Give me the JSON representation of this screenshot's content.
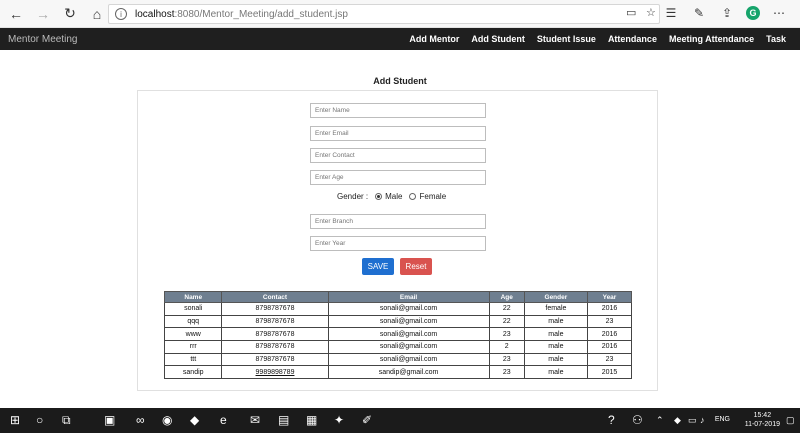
{
  "browser": {
    "url_host": "localhost",
    "url_path": ":8080/Mentor_Meeting/add_student.jsp",
    "icons": [
      "back-icon",
      "forward-icon",
      "refresh-icon",
      "home-icon",
      "info-icon",
      "reader-icon",
      "favorite-icon",
      "favorites-list-icon",
      "pen-icon",
      "share-icon",
      "grammarly-icon",
      "more-icon"
    ]
  },
  "app": {
    "brand": "Mentor Meeting",
    "nav": [
      "Add Mentor",
      "Add Student",
      "Student Issue",
      "Attendance",
      "Meeting Attendance",
      "Task"
    ]
  },
  "form": {
    "title": "Add Student",
    "name_placeholder": "Enter Name",
    "email_placeholder": "Enter Email",
    "contact_placeholder": "Enter Contact",
    "age_placeholder": "Enter Age",
    "gender_label": "Gender :",
    "gender_options": [
      "Male",
      "Female"
    ],
    "gender_selected": "Male",
    "branch_placeholder": "Enter Branch",
    "year_placeholder": "Enter Year",
    "save_label": "SAVE",
    "reset_label": "Reset"
  },
  "table": {
    "headers": [
      "Name",
      "Contact",
      "Email",
      "Age",
      "Gender",
      "Year"
    ],
    "rows": [
      [
        "sonali",
        "8798787678",
        "sonali@gmail.com",
        "22",
        "female",
        "2016"
      ],
      [
        "qqq",
        "8798787678",
        "sonali@gmail.com",
        "22",
        "male",
        "23"
      ],
      [
        "www",
        "8798787678",
        "sonali@gmail.com",
        "23",
        "male",
        "2016"
      ],
      [
        "rrr",
        "8798787678",
        "sonali@gmail.com",
        "2",
        "male",
        "2016"
      ],
      [
        "ttt",
        "8798787678",
        "sonali@gmail.com",
        "23",
        "male",
        "23"
      ],
      [
        "sandip",
        "9989898789",
        "sandip@gmail.com",
        "23",
        "male",
        "2015"
      ]
    ]
  },
  "taskbar": {
    "time": "15:42",
    "date": "11-07-2019",
    "lang": "ENG",
    "colors": {
      "start": "#ffffff",
      "edge": "#1e90ff",
      "chrome": "#f4b400",
      "dropbox": "#0061fe"
    }
  }
}
